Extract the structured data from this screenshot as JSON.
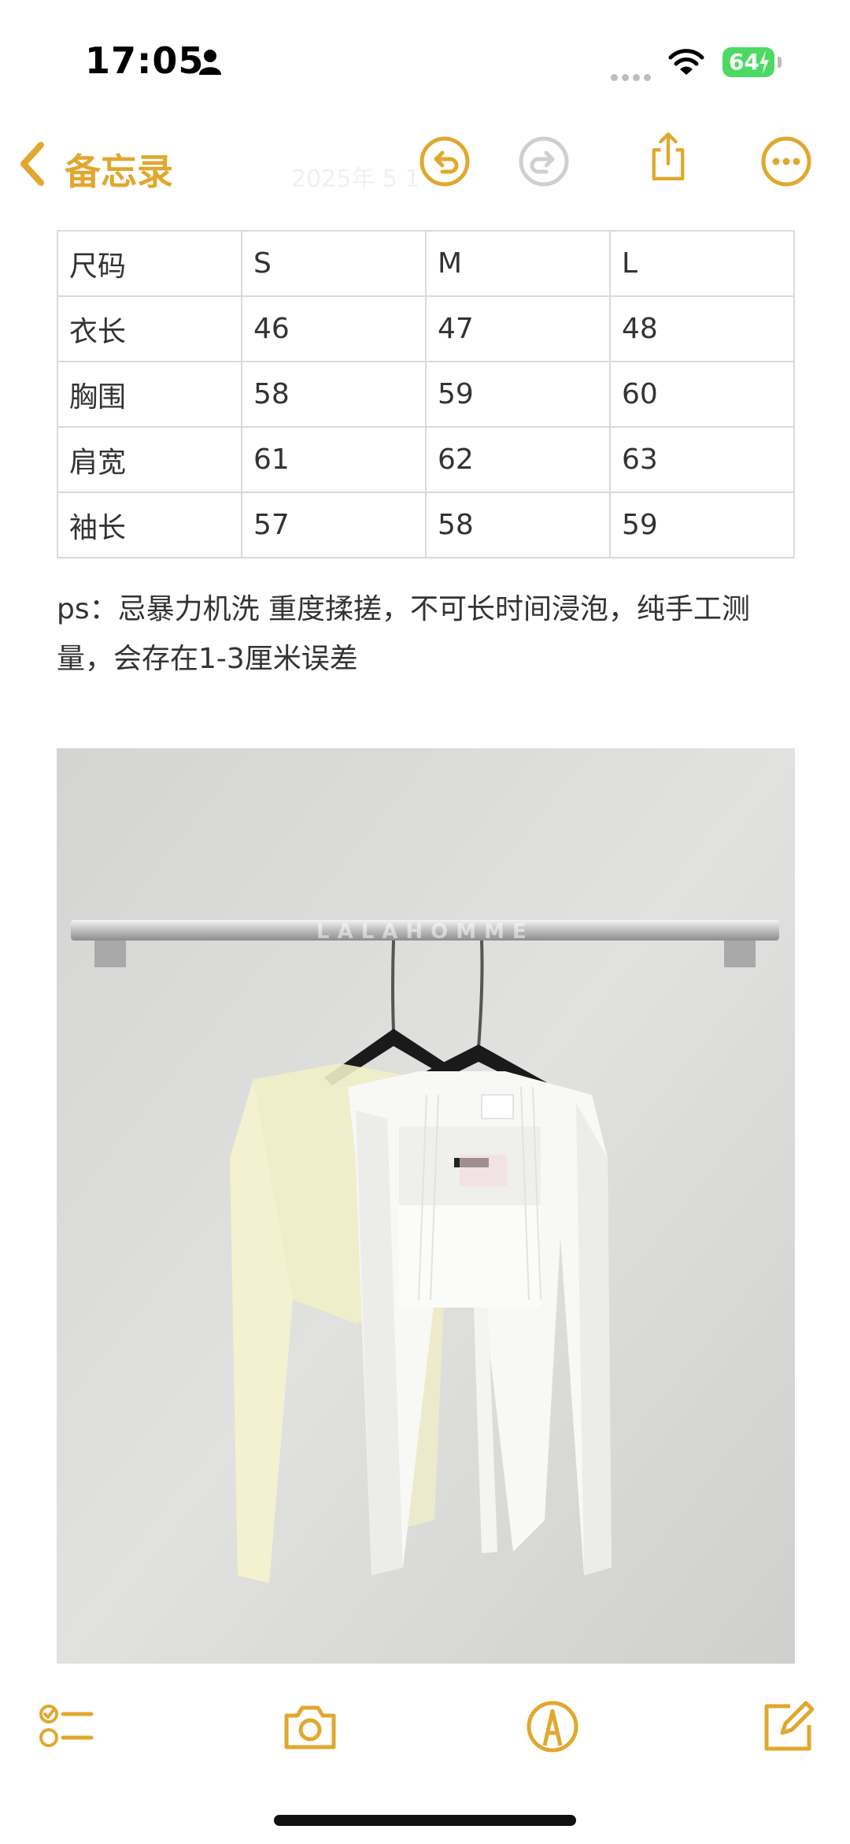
{
  "status_bar": {
    "time": "17:05",
    "battery_level": "64",
    "battery_color": "#4cd964"
  },
  "nav": {
    "back_label": "备忘录",
    "faded_date": "2025年 5     1",
    "accent_color": "#e0a82e",
    "icons": [
      "chevron-left-icon",
      "undo-icon",
      "redo-icon",
      "share-icon",
      "more-icon"
    ]
  },
  "size_table": {
    "headers": [
      "尺码",
      "S",
      "M",
      "L"
    ],
    "rows": [
      [
        "衣长",
        "46",
        "47",
        "48"
      ],
      [
        "胸围",
        "58",
        "59",
        "60"
      ],
      [
        "肩宽",
        "61",
        "62",
        "63"
      ],
      [
        "袖长",
        "57",
        "58",
        "59"
      ]
    ]
  },
  "note": {
    "text": "ps：忌暴力机洗 重度揉搓，不可长时间浸泡，纯手工测量，会存在1-3厘米误差"
  },
  "photo": {
    "watermark": "LALAHOMME"
  },
  "toolbar": {
    "icons": [
      "checklist-icon",
      "camera-icon",
      "markup-icon",
      "compose-icon"
    ]
  }
}
